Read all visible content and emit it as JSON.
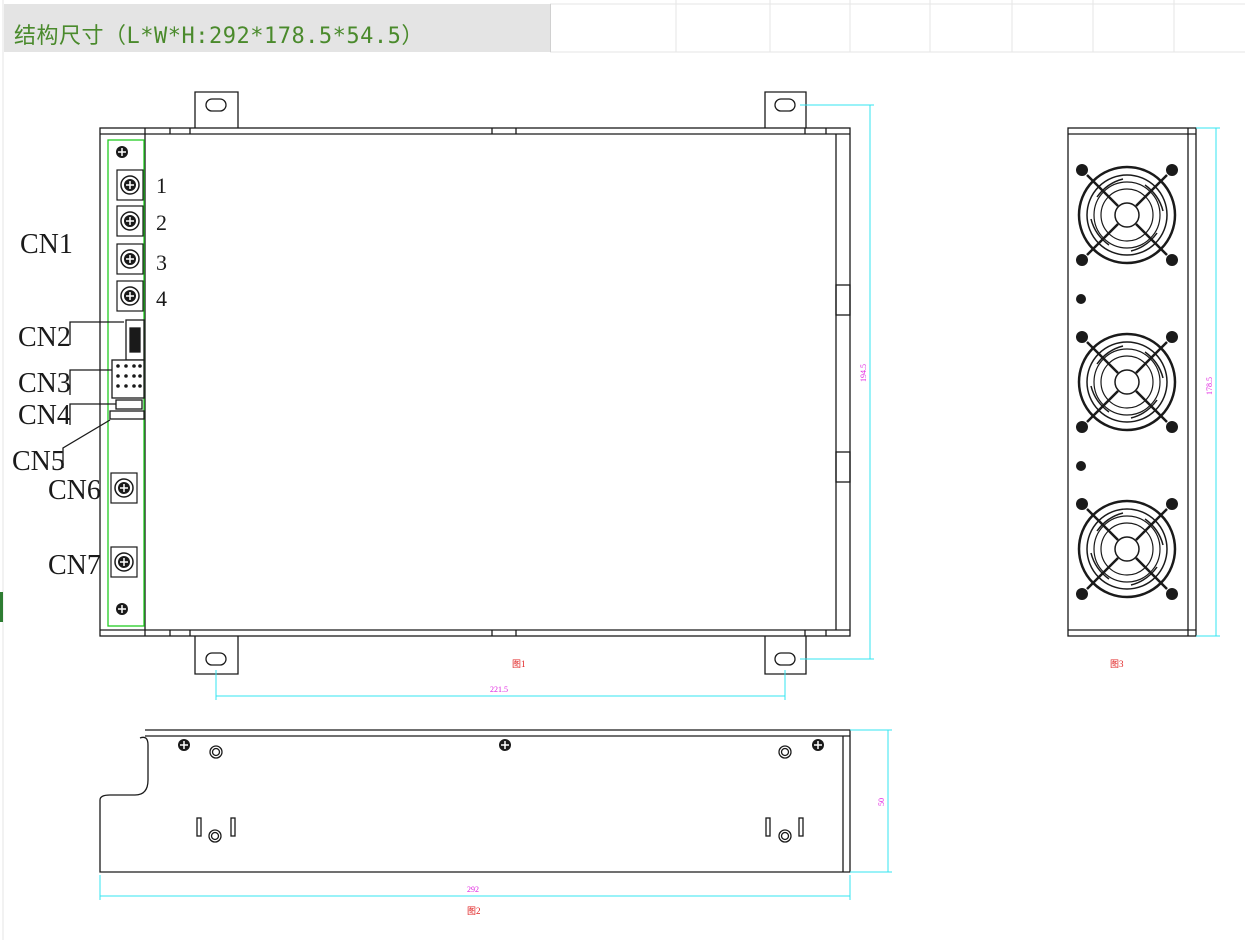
{
  "header": {
    "title": "结构尺寸（L*W*H:292*178.5*54.5）"
  },
  "connectors": {
    "cn1": "CN1",
    "cn2": "CN2",
    "cn3": "CN3",
    "cn4": "CN4",
    "cn5": "CN5",
    "cn6": "CN6",
    "cn7": "CN7",
    "terminals": [
      "1",
      "2",
      "3",
      "4"
    ]
  },
  "dimensions": {
    "height_front": "194.5",
    "height_side": "178.5",
    "hole_spacing": "221.5",
    "depth": "50",
    "length": "292"
  },
  "figure_labels": {
    "fig1": "图1",
    "fig2": "图2",
    "fig3": "图3"
  },
  "colors": {
    "title_text": "#4a8a2c",
    "title_bg": "#e4e4e4",
    "dimension_line": "#33e6f0",
    "dimension_text": "#e020e0",
    "figure_label": "#e02020",
    "highlight_box": "#22cc22",
    "drawing_line": "#1a1a1a"
  }
}
